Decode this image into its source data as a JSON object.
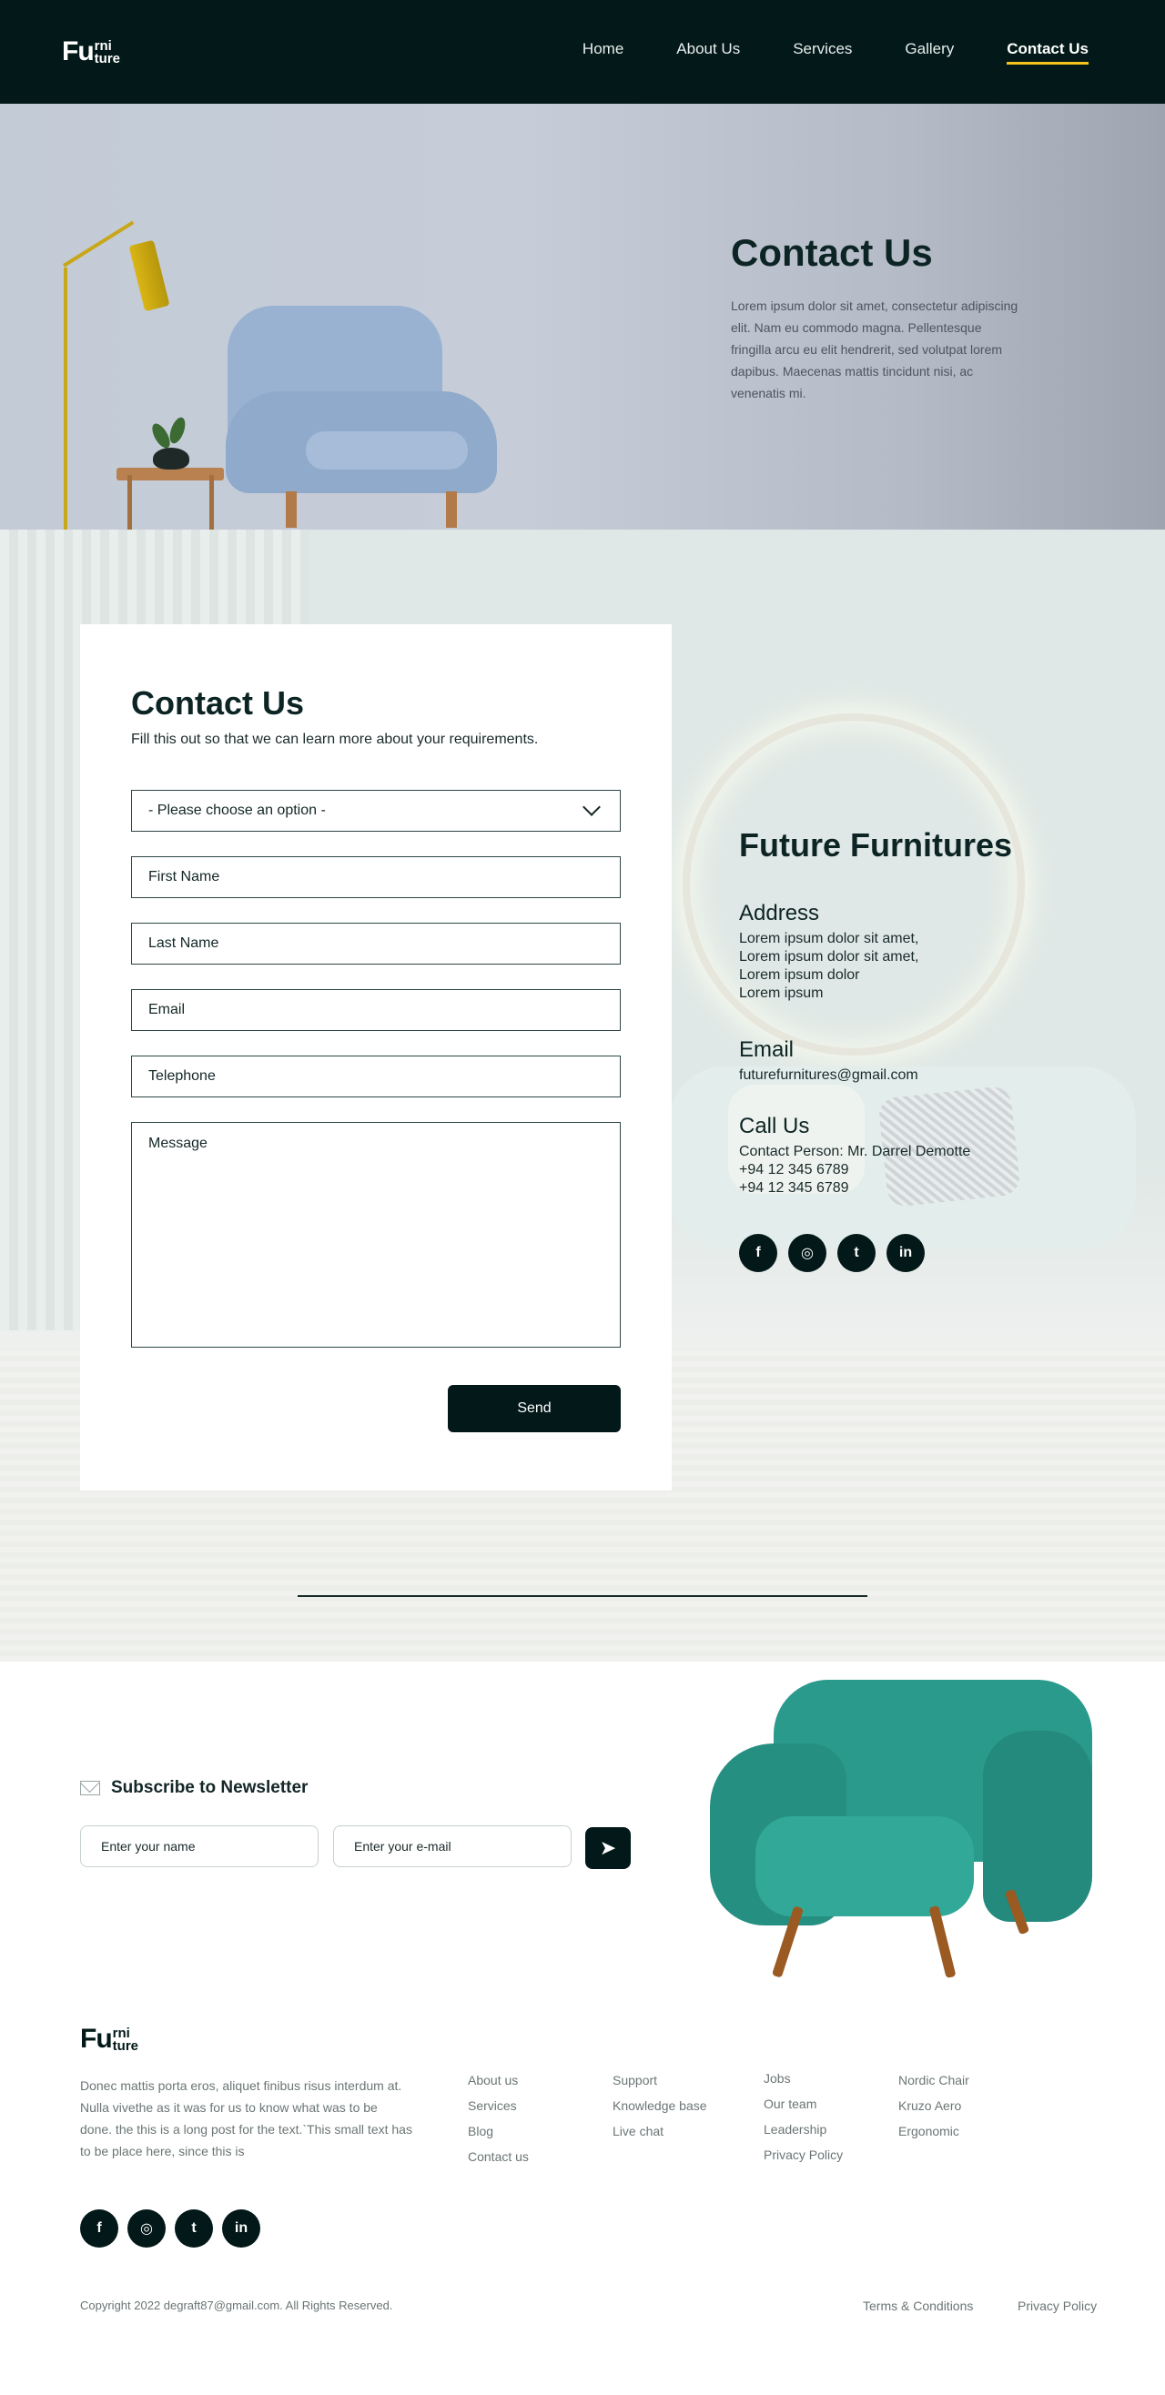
{
  "brand": {
    "logo_big": "Fu",
    "logo_top": "rni",
    "logo_bottom": "ture"
  },
  "nav": {
    "items": [
      "Home",
      "About Us",
      "Services",
      "Gallery",
      "Contact Us"
    ],
    "active_index": 4,
    "accent_color": "#f2c31b"
  },
  "hero": {
    "title": "Contact Us",
    "text": "Lorem ipsum dolor sit amet, consectetur adipiscing elit. Nam eu commodo magna. Pellentesque fringilla arcu eu elit hendrerit, sed volutpat lorem dapibus. Maecenas mattis tincidunt nisi, ac venenatis mi."
  },
  "form": {
    "title": "Contact Us",
    "subtitle": "Fill this out so that we can learn more about your requirements.",
    "select_placeholder": "- Please choose an option -",
    "first_name": "First Name",
    "last_name": "Last Name",
    "email": "Email",
    "telephone": "Telephone",
    "message": "Message",
    "send": "Send"
  },
  "info": {
    "company": "Future Furnitures",
    "address_title": "Address",
    "address_lines": [
      "Lorem ipsum dolor sit amet,",
      "Lorem ipsum dolor sit amet,",
      "Lorem ipsum dolor",
      "Lorem ipsum"
    ],
    "email_title": "Email",
    "email": "futurefurnitures@gmail.com",
    "call_title": "Call Us",
    "contact_person": "Contact Person: Mr. Darrel Demotte",
    "phones": [
      "+94 12 345 6789",
      "+94 12 345 6789"
    ],
    "social_icons": [
      "facebook-icon",
      "instagram-icon",
      "twitter-icon",
      "linkedin-icon"
    ],
    "social_glyphs": [
      "f",
      "◎",
      "t",
      "in"
    ]
  },
  "newsletter": {
    "title": "Subscribe to Newsletter",
    "name_placeholder": "Enter your name",
    "email_placeholder": "Enter your e-mail"
  },
  "footer": {
    "description": "Donec mattis porta eros, aliquet finibus risus interdum at. Nulla vivethe as it was for us to know what was to be done. the this is a long  post for the text.`This small text has to be place here, since this is",
    "col1": [
      "About us",
      "Services",
      "Blog",
      "Contact us"
    ],
    "col2": [
      "Support",
      "Knowledge base",
      "Live chat"
    ],
    "col3": [
      "Jobs",
      "Our team",
      "Leadership",
      "Privacy Policy"
    ],
    "col4": [
      "Nordic Chair",
      "Kruzo Aero",
      "Ergonomic"
    ],
    "copyright": "Copyright 2022 degraft87@gmail.com. All Rights Reserved.",
    "terms": "Terms & Conditions",
    "privacy": "Privacy Policy"
  }
}
